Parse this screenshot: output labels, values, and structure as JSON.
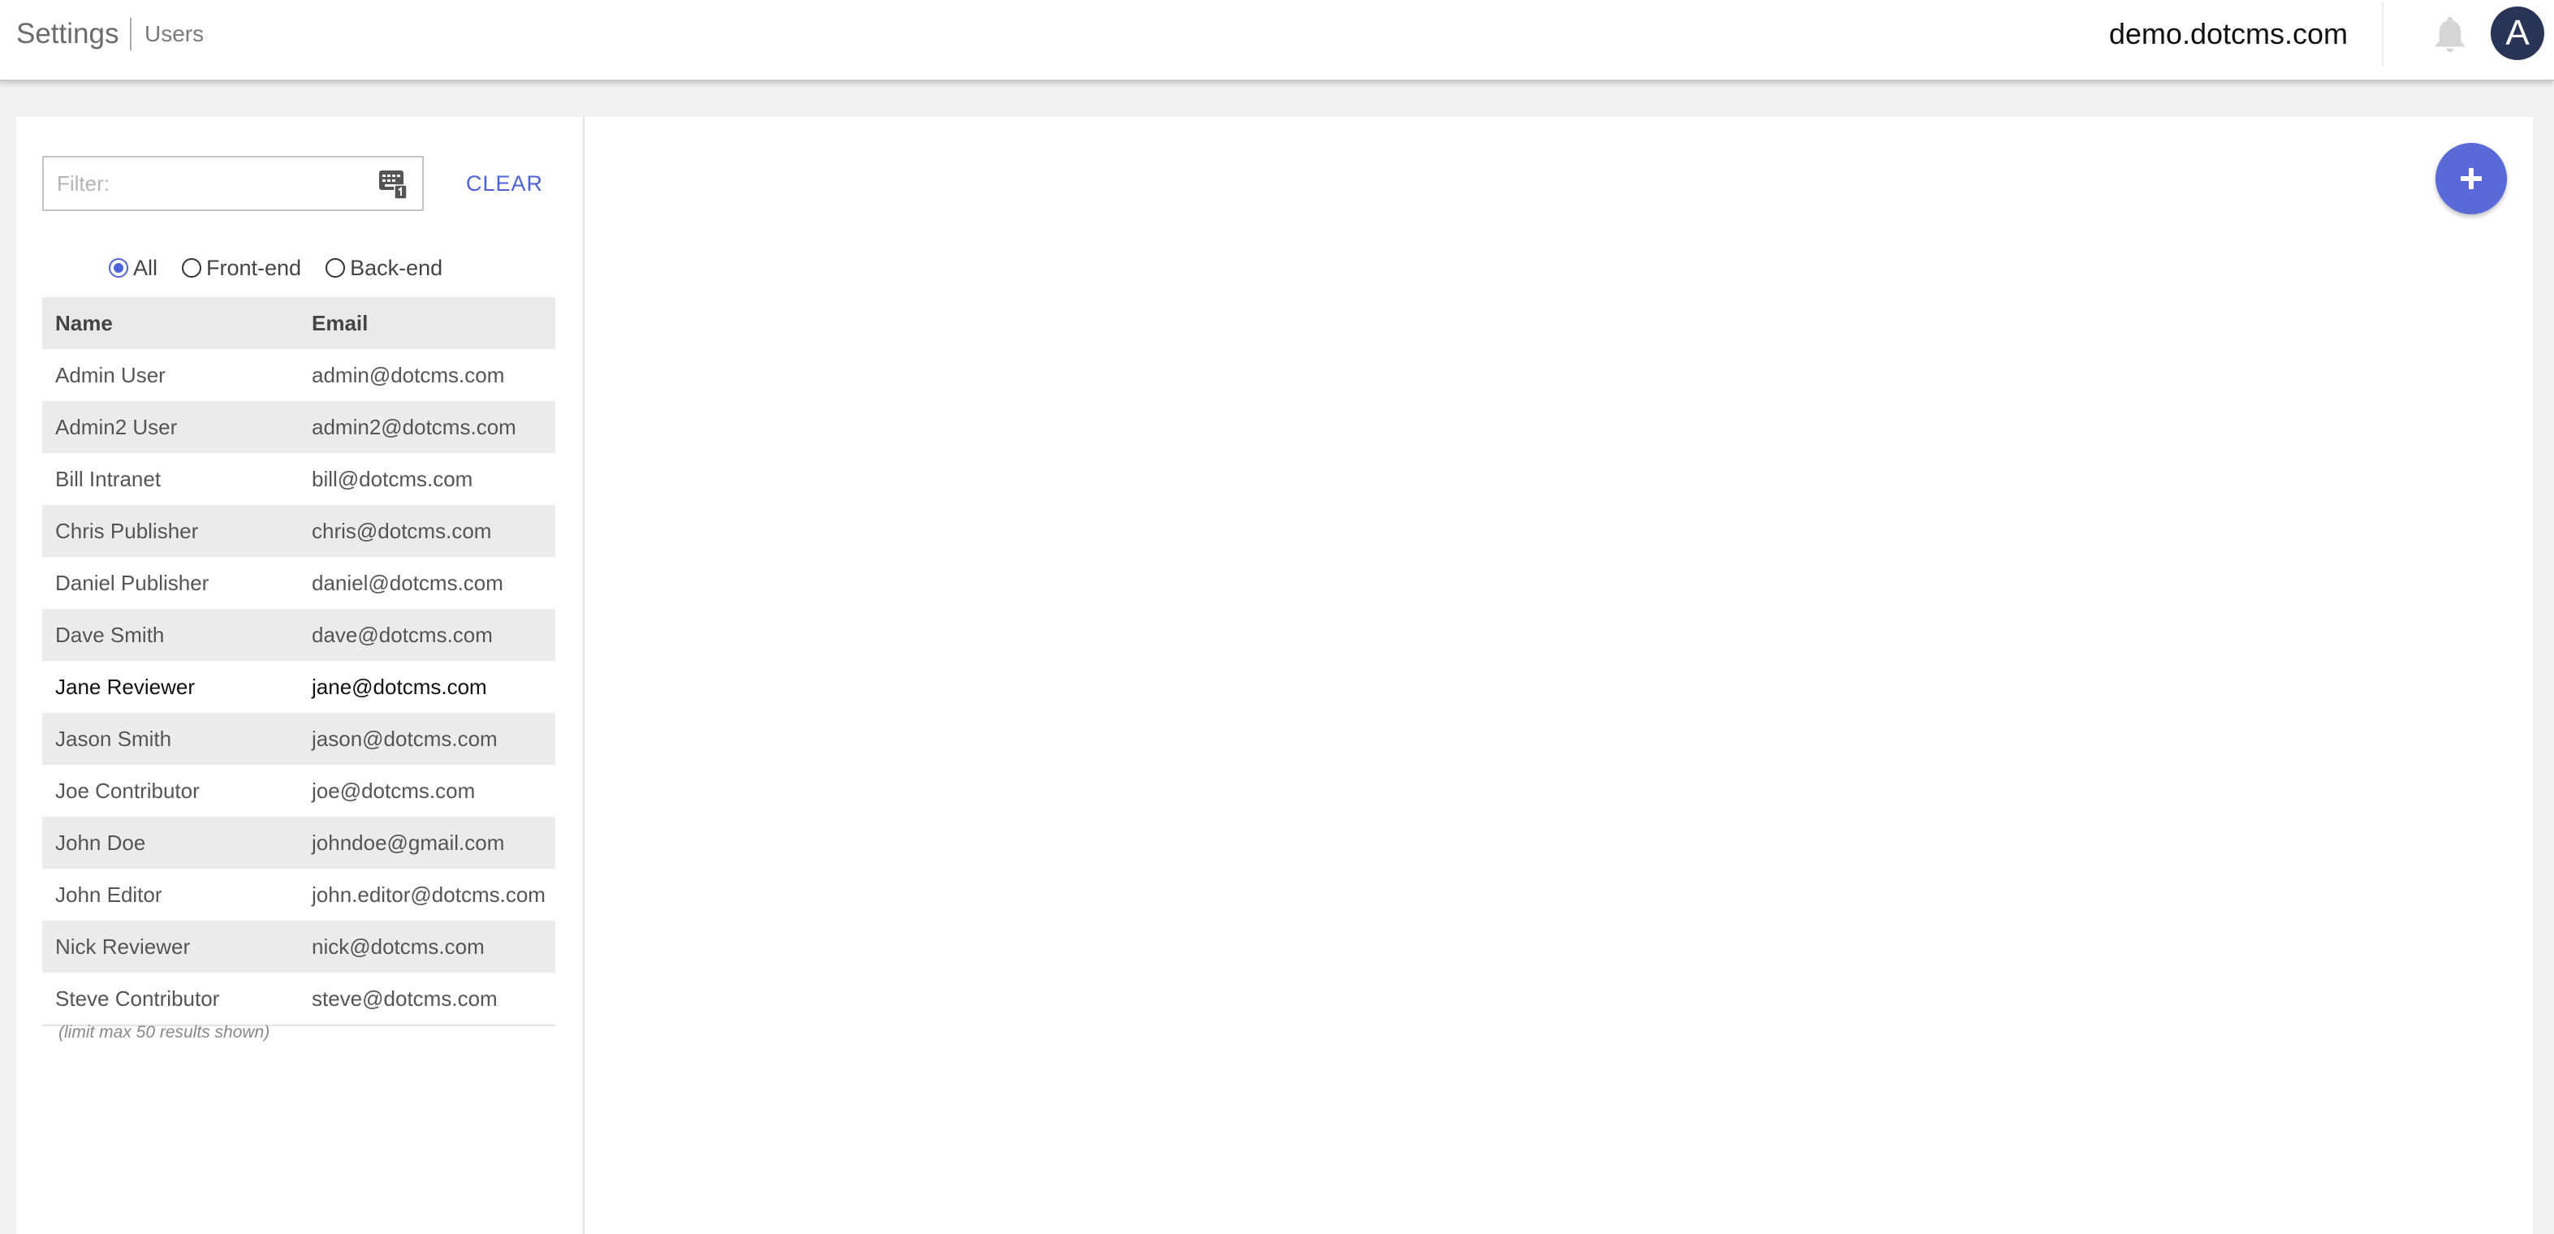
{
  "header": {
    "title": "Settings",
    "subtitle": "Users",
    "site": "demo.dotcms.com",
    "avatar_initial": "A"
  },
  "filter": {
    "placeholder": "Filter:",
    "value": "",
    "clear_label": "CLEAR"
  },
  "user_types": {
    "options": [
      "All",
      "Front-end",
      "Back-end"
    ],
    "selected": "All"
  },
  "table": {
    "columns": [
      "Name",
      "Email"
    ],
    "rows": [
      {
        "name": "Admin User",
        "email": "admin@dotcms.com"
      },
      {
        "name": "Admin2 User",
        "email": "admin2@dotcms.com"
      },
      {
        "name": "Bill Intranet",
        "email": "bill@dotcms.com"
      },
      {
        "name": "Chris Publisher",
        "email": "chris@dotcms.com"
      },
      {
        "name": "Daniel Publisher",
        "email": "daniel@dotcms.com"
      },
      {
        "name": "Dave Smith",
        "email": "dave@dotcms.com"
      },
      {
        "name": "Jane Reviewer",
        "email": "jane@dotcms.com"
      },
      {
        "name": "Jason Smith",
        "email": "jason@dotcms.com"
      },
      {
        "name": "Joe Contributor",
        "email": "joe@dotcms.com"
      },
      {
        "name": "John Doe",
        "email": "johndoe@gmail.com"
      },
      {
        "name": "John Editor",
        "email": "john.editor@dotcms.com"
      },
      {
        "name": "Nick Reviewer",
        "email": "nick@dotcms.com"
      },
      {
        "name": "Steve Contributor",
        "email": "steve@dotcms.com"
      }
    ],
    "highlighted_row": 6,
    "limit_note": "(limit max 50 results shown)"
  },
  "icons": {
    "notifications": "bell-icon",
    "keyboard": "keyboard-icon",
    "add": "plus-icon"
  },
  "colors": {
    "accent": "#4f63d8",
    "fab": "#5a68d8",
    "avatar_bg": "#2a3457"
  }
}
